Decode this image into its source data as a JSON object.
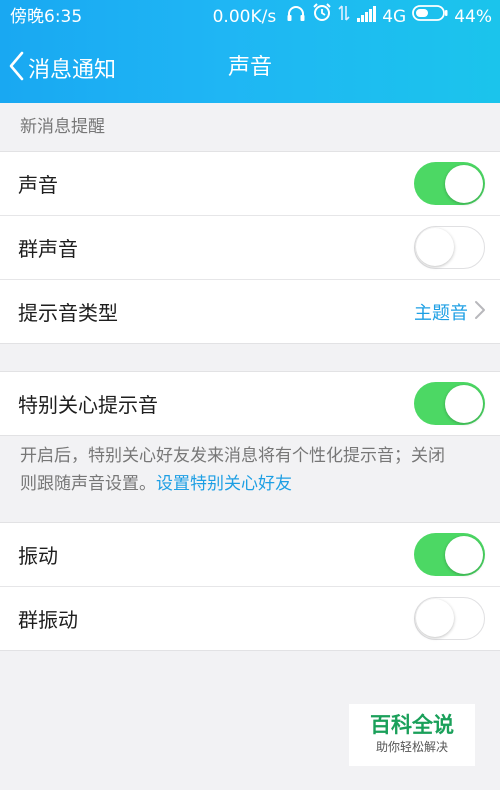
{
  "status_bar": {
    "time": "傍晚6:35",
    "network_speed": "0.00K/s",
    "network_type": "4G",
    "battery": "44%",
    "icons": [
      "headphones-icon",
      "alarm-icon",
      "data-transfer-icon",
      "signal-icon",
      "battery-icon"
    ]
  },
  "nav": {
    "back_label": "消息通知",
    "title": "声音"
  },
  "section_new_message": {
    "header": "新消息提醒",
    "rows": [
      {
        "label": "声音",
        "toggle": true
      },
      {
        "label": "群声音",
        "toggle": false
      },
      {
        "label": "提示音类型",
        "value": "主题音"
      }
    ]
  },
  "special_care": {
    "label": "特别关心提示音",
    "toggle": true,
    "description": "开启后，特别关心好友发来消息将有个性化提示音；关闭则跟随声音设置。",
    "link": "设置特别关心好友"
  },
  "vibration": {
    "rows": [
      {
        "label": "振动",
        "toggle": true
      },
      {
        "label": "群振动",
        "toggle": false
      }
    ]
  },
  "watermark": {
    "title": "百科全说",
    "subtitle": "助你轻松解决"
  },
  "colors": {
    "header_gradient_start": "#19a8f2",
    "header_gradient_end": "#1bc4ec",
    "toggle_on": "#4cd864",
    "link": "#1d9fe4",
    "watermark_green": "#1aa05a"
  }
}
